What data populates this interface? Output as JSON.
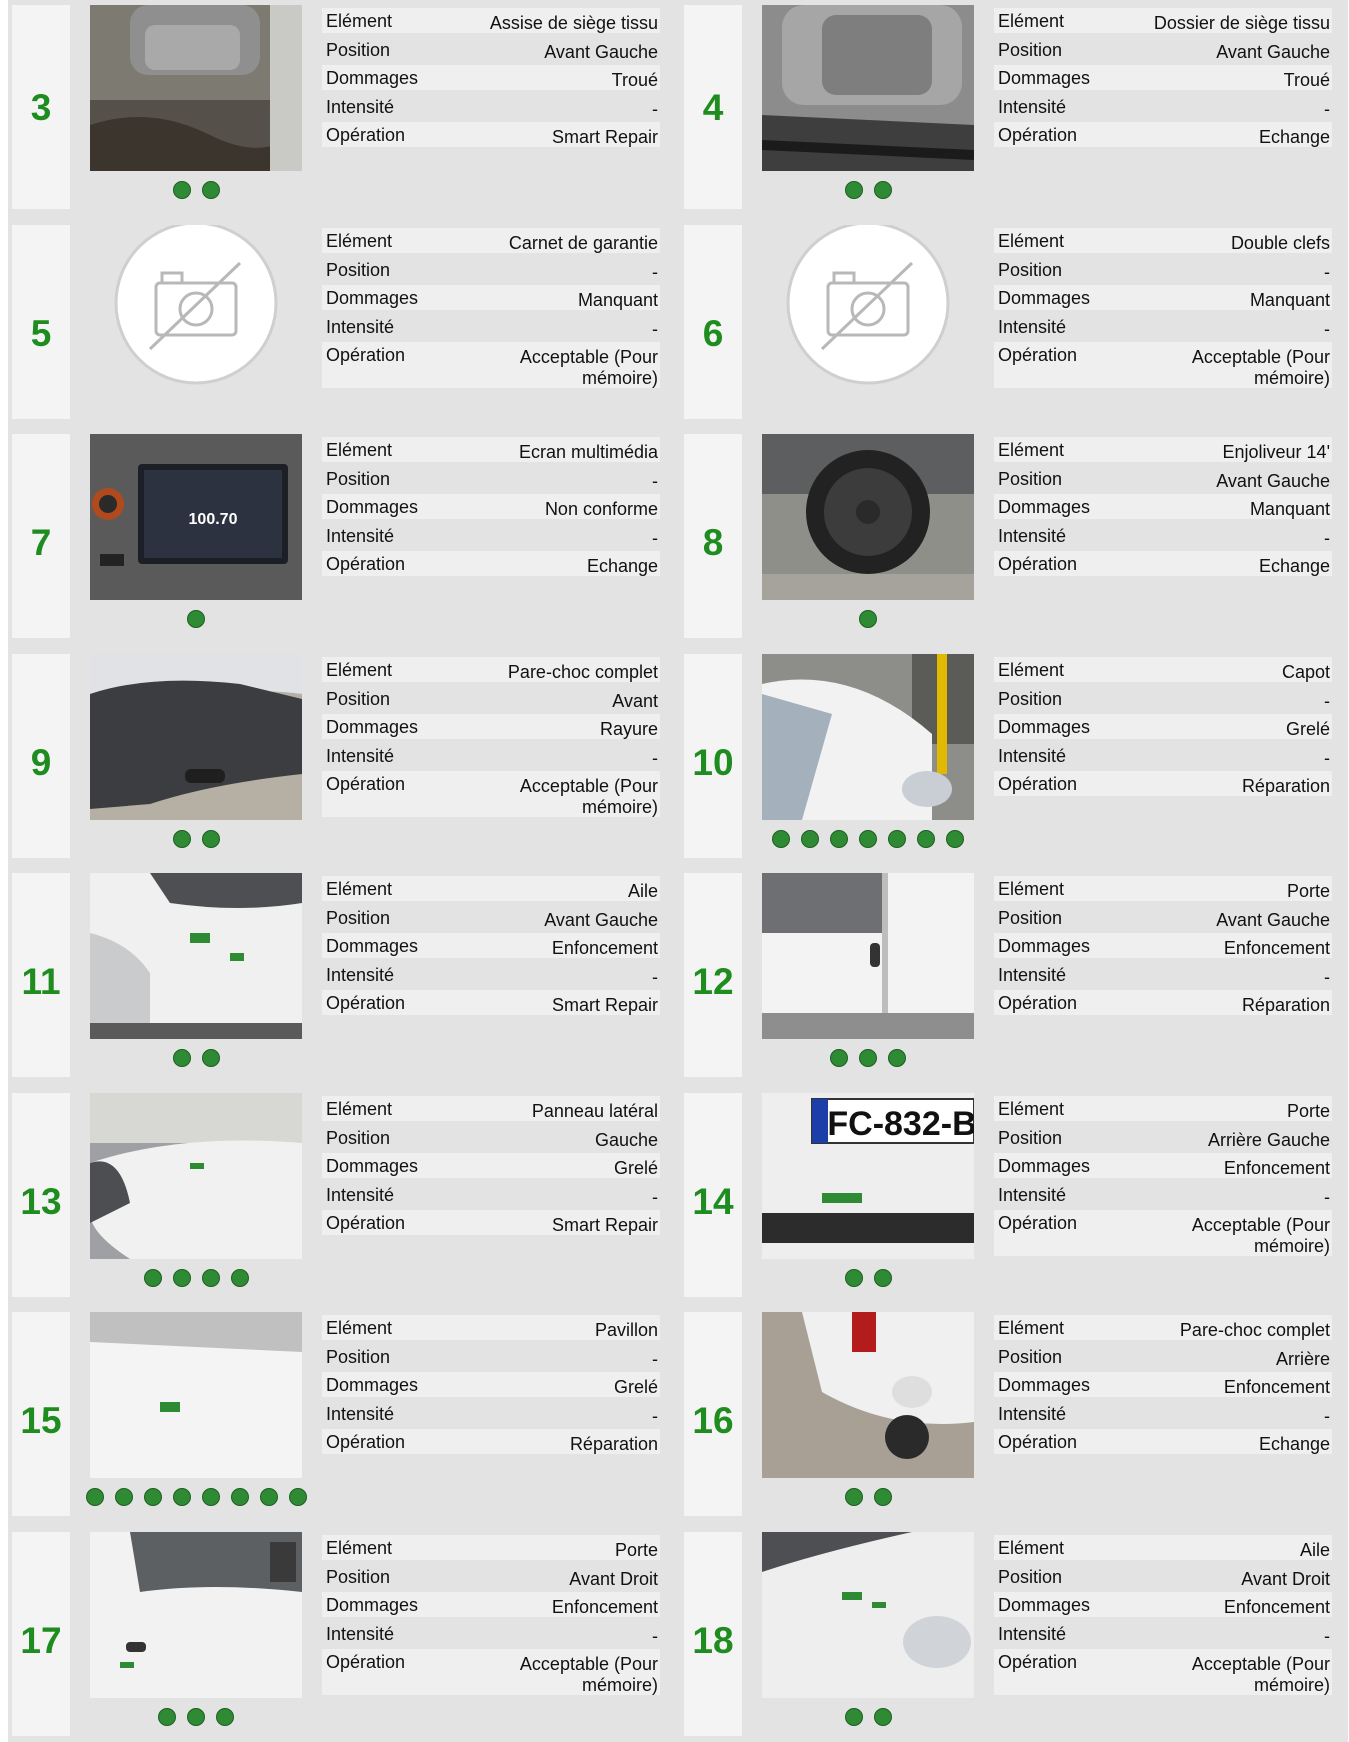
{
  "labels": {
    "element": "Elément",
    "position": "Position",
    "dommages": "Dommages",
    "intensite": "Intensité",
    "operation": "Opération"
  },
  "items": [
    {
      "num": "3",
      "element": "Assise de siège tissu",
      "position": "Avant Gauche",
      "dommages": "Troué",
      "intensite": "-",
      "operation": "Smart Repair",
      "photos": 2,
      "photo": "seat-cushion-photo"
    },
    {
      "num": "4",
      "element": "Dossier de siège tissu",
      "position": "Avant Gauche",
      "dommages": "Troué",
      "intensite": "-",
      "operation": "Echange",
      "photos": 2,
      "photo": "seat-back-photo"
    },
    {
      "num": "5",
      "element": "Carnet de garantie",
      "position": "-",
      "dommages": "Manquant",
      "intensite": "-",
      "operation": "Acceptable (Pour mémoire)",
      "photos": 0,
      "photo": "no-photo-icon"
    },
    {
      "num": "6",
      "element": "Double clefs",
      "position": "-",
      "dommages": "Manquant",
      "intensite": "-",
      "operation": "Acceptable (Pour mémoire)",
      "photos": 0,
      "photo": "no-photo-icon"
    },
    {
      "num": "7",
      "element": "Ecran multimédia",
      "position": "-",
      "dommages": "Non conforme",
      "intensite": "-",
      "operation": "Echange",
      "photos": 1,
      "photo": "radio-screen-photo",
      "screen_text": "100.70"
    },
    {
      "num": "8",
      "element": "Enjoliveur 14'",
      "position": "Avant Gauche",
      "dommages": "Manquant",
      "intensite": "-",
      "operation": "Echange",
      "photos": 1,
      "photo": "wheel-photo"
    },
    {
      "num": "9",
      "element": "Pare-choc complet",
      "position": "Avant",
      "dommages": "Rayure",
      "intensite": "-",
      "operation": "Acceptable (Pour mémoire)",
      "photos": 2,
      "photo": "bumper-photo"
    },
    {
      "num": "10",
      "element": "Capot",
      "position": "-",
      "dommages": "Grelé",
      "intensite": "-",
      "operation": "Réparation",
      "photos": 7,
      "photo": "hood-photo"
    },
    {
      "num": "11",
      "element": "Aile",
      "position": "Avant Gauche",
      "dommages": "Enfoncement",
      "intensite": "-",
      "operation": "Smart Repair",
      "photos": 2,
      "photo": "fender-photo"
    },
    {
      "num": "12",
      "element": "Porte",
      "position": "Avant Gauche",
      "dommages": "Enfoncement",
      "intensite": "-",
      "operation": "Réparation",
      "photos": 3,
      "photo": "door-photo"
    },
    {
      "num": "13",
      "element": "Panneau latéral",
      "position": "Gauche",
      "dommages": "Grelé",
      "intensite": "-",
      "operation": "Smart Repair",
      "photos": 4,
      "photo": "side-panel-photo"
    },
    {
      "num": "14",
      "element": "Porte",
      "position": "Arrière Gauche",
      "dommages": "Enfoncement",
      "intensite": "-",
      "operation": "Acceptable (Pour mémoire)",
      "photos": 2,
      "photo": "rear-door-photo",
      "plate_text": "FC-832-B"
    },
    {
      "num": "15",
      "element": "Pavillon",
      "position": "-",
      "dommages": "Grelé",
      "intensite": "-",
      "operation": "Réparation",
      "photos": 8,
      "photo": "roof-photo"
    },
    {
      "num": "16",
      "element": "Pare-choc complet",
      "position": "Arrière",
      "dommages": "Enfoncement",
      "intensite": "-",
      "operation": "Echange",
      "photos": 2,
      "photo": "rear-bumper-photo"
    },
    {
      "num": "17",
      "element": "Porte",
      "position": "Avant Droit",
      "dommages": "Enfoncement",
      "intensite": "-",
      "operation": "Acceptable (Pour mémoire)",
      "photos": 3,
      "photo": "right-door-photo"
    },
    {
      "num": "18",
      "element": "Aile",
      "position": "Avant Droit",
      "dommages": "Enfoncement",
      "intensite": "-",
      "operation": "Acceptable (Pour mémoire)",
      "photos": 2,
      "photo": "right-fender-photo"
    }
  ]
}
